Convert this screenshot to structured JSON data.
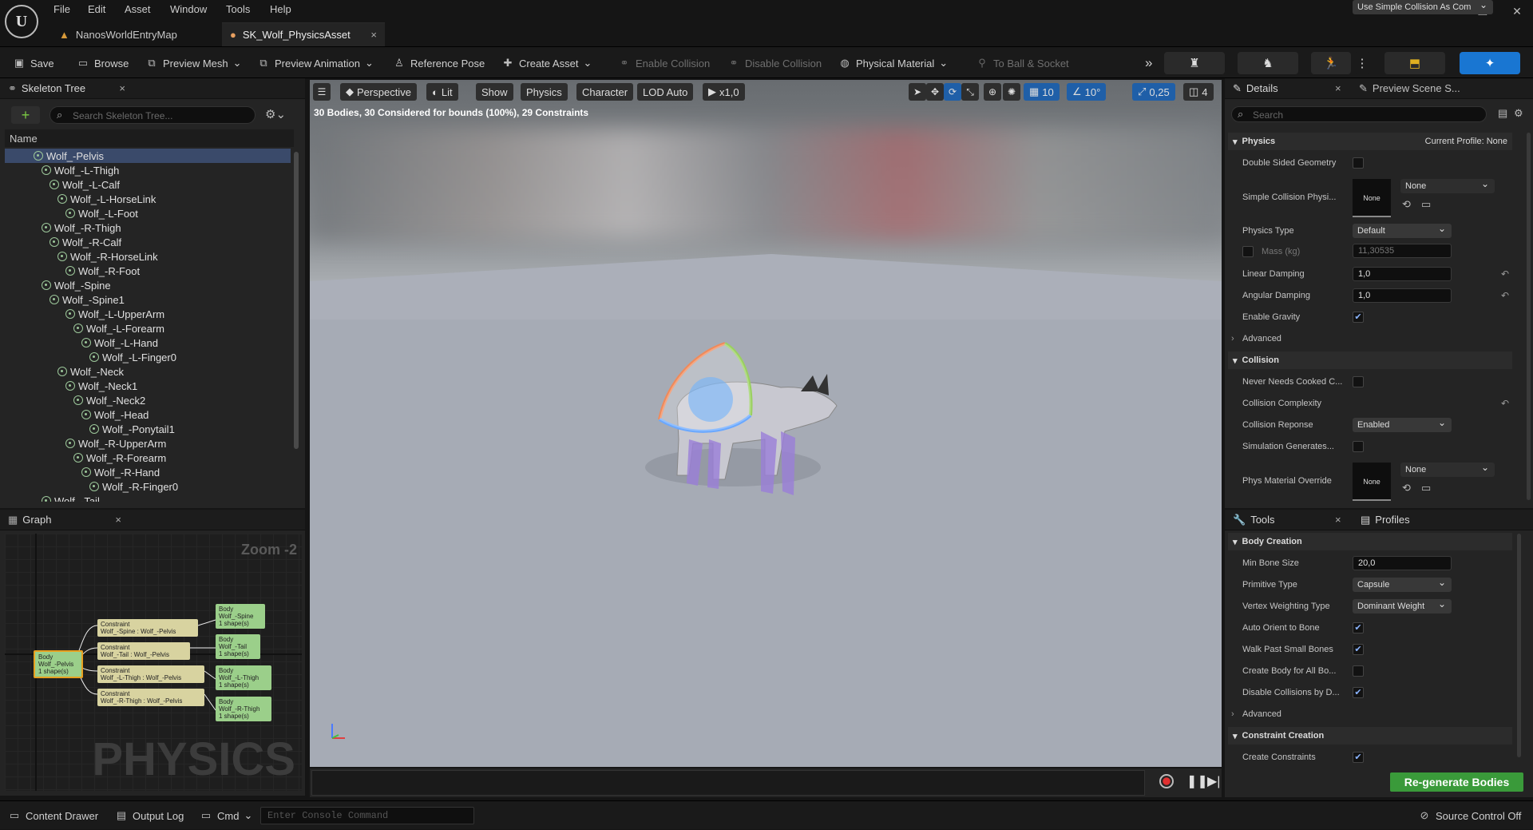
{
  "menu": [
    "File",
    "Edit",
    "Asset",
    "Window",
    "Tools",
    "Help"
  ],
  "tabs": [
    {
      "label": "NanosWorldEntryMap"
    },
    {
      "label": "SK_Wolf_PhysicsAsset",
      "close": "×"
    }
  ],
  "toolbar": {
    "save": "Save",
    "browse": "Browse",
    "preview_mesh": "Preview Mesh",
    "preview_animation": "Preview Animation",
    "reference_pose": "Reference Pose",
    "create_asset": "Create Asset",
    "enable_collision": "Enable Collision",
    "disable_collision": "Disable Collision",
    "physical_material": "Physical Material",
    "to_ball_socket": "To Ball & Socket"
  },
  "skeleton_tree": {
    "title": "Skeleton Tree",
    "search_placeholder": "Search Skeleton Tree...",
    "column": "Name",
    "bones": [
      {
        "name": "Wolf_-Pelvis",
        "depth": 0
      },
      {
        "name": "Wolf_-L-Thigh",
        "depth": 1
      },
      {
        "name": "Wolf_-L-Calf",
        "depth": 2
      },
      {
        "name": "Wolf_-L-HorseLink",
        "depth": 3
      },
      {
        "name": "Wolf_-L-Foot",
        "depth": 4
      },
      {
        "name": "Wolf_-R-Thigh",
        "depth": 1
      },
      {
        "name": "Wolf_-R-Calf",
        "depth": 2
      },
      {
        "name": "Wolf_-R-HorseLink",
        "depth": 3
      },
      {
        "name": "Wolf_-R-Foot",
        "depth": 4
      },
      {
        "name": "Wolf_-Spine",
        "depth": 1
      },
      {
        "name": "Wolf_-Spine1",
        "depth": 2
      },
      {
        "name": "Wolf_-L-UpperArm",
        "depth": 4
      },
      {
        "name": "Wolf_-L-Forearm",
        "depth": 5
      },
      {
        "name": "Wolf_-L-Hand",
        "depth": 6
      },
      {
        "name": "Wolf_-L-Finger0",
        "depth": 7
      },
      {
        "name": "Wolf_-Neck",
        "depth": 3
      },
      {
        "name": "Wolf_-Neck1",
        "depth": 4
      },
      {
        "name": "Wolf_-Neck2",
        "depth": 5
      },
      {
        "name": "Wolf_-Head",
        "depth": 6
      },
      {
        "name": "Wolf_-Ponytail1",
        "depth": 7
      },
      {
        "name": "Wolf_-R-UpperArm",
        "depth": 4
      },
      {
        "name": "Wolf_-R-Forearm",
        "depth": 5
      },
      {
        "name": "Wolf_-R-Hand",
        "depth": 6
      },
      {
        "name": "Wolf_-R-Finger0",
        "depth": 7
      },
      {
        "name": "Wolf_-Tail",
        "depth": 1
      }
    ]
  },
  "graph": {
    "title": "Graph",
    "zoom": "Zoom -2",
    "watermark": "PHYSICS",
    "root": [
      "Body",
      "Wolf_-Pelvis",
      "1 shape(s)"
    ],
    "constraints": [
      [
        "Constraint",
        "Wolf_-Spine : Wolf_-Pelvis"
      ],
      [
        "Constraint",
        "Wolf_-Tail : Wolf_-Pelvis"
      ],
      [
        "Constraint",
        "Wolf_-L-Thigh : Wolf_-Pelvis"
      ],
      [
        "Constraint",
        "Wolf_-R-Thigh : Wolf_-Pelvis"
      ]
    ],
    "bodies": [
      [
        "Body",
        "Wolf_-Spine",
        "1 shape(s)"
      ],
      [
        "Body",
        "Wolf_-Tail",
        "1 shape(s)"
      ],
      [
        "Body",
        "Wolf_-L-Thigh",
        "1 shape(s)"
      ],
      [
        "Body",
        "Wolf_-R-Thigh",
        "1 shape(s)"
      ]
    ]
  },
  "viewport": {
    "perspective": "Perspective",
    "lit": "Lit",
    "show": "Show",
    "physics": "Physics",
    "character": "Character",
    "lod": "LOD Auto",
    "speed": "x1,0",
    "grid": "10",
    "angle": "10°",
    "scale": "0,25",
    "camera": "4",
    "info": "30 Bodies, 30 Considered for bounds (100%), 29 Constraints"
  },
  "details": {
    "title": "Details",
    "tab2": "Preview Scene S...",
    "search_placeholder": "Search",
    "physics_header": "Physics",
    "current_profile": "Current Profile: None",
    "double_sided": "Double Sided Geometry",
    "simple_collision": "Simple Collision Physi...",
    "thumb_none": "None",
    "none": "None",
    "physics_type_label": "Physics Type",
    "physics_type": "Default",
    "mass_label": "Mass (kg)",
    "mass": "11,30535",
    "linear_damping_label": "Linear Damping",
    "linear_damping": "1,0",
    "angular_damping_label": "Angular Damping",
    "angular_damping": "1,0",
    "enable_gravity": "Enable Gravity",
    "advanced": "Advanced",
    "collision_header": "Collision",
    "never_needs": "Never Needs Cooked C...",
    "complexity_label": "Collision Complexity",
    "complexity": "Use Simple Collision As Com",
    "response_label": "Collision Reponse",
    "response": "Enabled",
    "sim_generates": "Simulation Generates...",
    "phys_mat_override": "Phys Material Override"
  },
  "tools": {
    "title": "Tools",
    "profiles": "Profiles",
    "body_creation": "Body Creation",
    "min_bone_label": "Min Bone Size",
    "min_bone": "20,0",
    "primitive_label": "Primitive Type",
    "primitive": "Capsule",
    "vertex_label": "Vertex Weighting Type",
    "vertex": "Dominant Weight",
    "auto_orient": "Auto Orient to Bone",
    "walk_past": "Walk Past Small Bones",
    "create_body_all": "Create Body for All Bo...",
    "disable_collisions": "Disable Collisions by D...",
    "advanced": "Advanced",
    "constraint_creation": "Constraint Creation",
    "create_constraints": "Create Constraints",
    "regenerate": "Re-generate Bodies"
  },
  "statusbar": {
    "content_drawer": "Content Drawer",
    "output_log": "Output Log",
    "cmd": "Cmd",
    "console_placeholder": "Enter Console Command",
    "source_control": "Source Control Off"
  }
}
